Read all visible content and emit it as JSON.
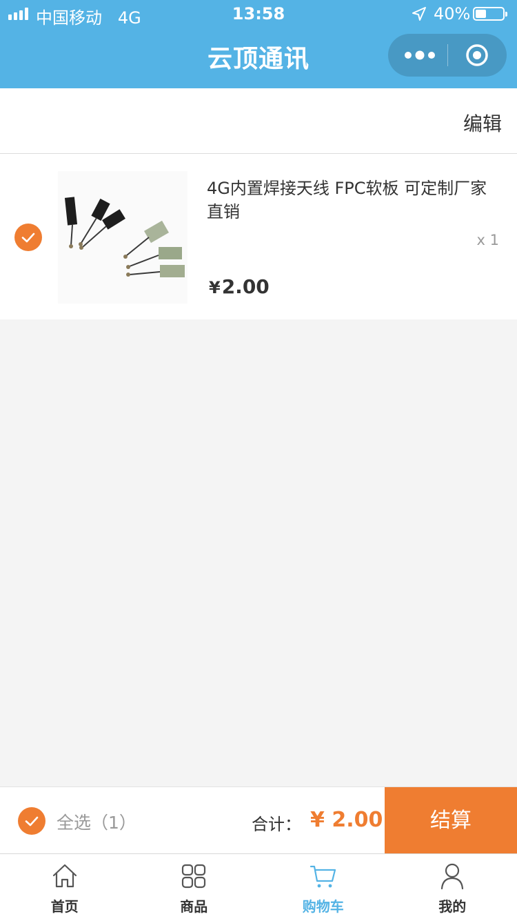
{
  "status_bar": {
    "carrier": "中国移动",
    "network": "4G",
    "time": "13:58",
    "battery_text": "40%",
    "battery_level": 0.4
  },
  "nav": {
    "title": "云顶通讯",
    "more_icon": "more-dots-icon",
    "close_icon": "target-circle-icon"
  },
  "cart": {
    "edit_label": "编辑",
    "items": [
      {
        "title": "4G内置焊接天线 FPC软板 可定制厂家直销",
        "quantity": "x 1",
        "price_currency": "¥",
        "price_value": "2.00",
        "checked": true
      }
    ]
  },
  "checkout": {
    "select_all": "全选（1）",
    "total_label": "合计：",
    "total_value": "¥ 2.00",
    "settle_button": "结算"
  },
  "tabbar": {
    "tabs": [
      {
        "label": "首页",
        "icon": "home-icon"
      },
      {
        "label": "商品",
        "icon": "grid-icon"
      },
      {
        "label": "购物车",
        "icon": "cart-icon",
        "active": true
      },
      {
        "label": "我的",
        "icon": "user-icon"
      }
    ]
  },
  "colors": {
    "brand_blue": "#54b3e5",
    "accent_orange": "#ef7d31"
  }
}
